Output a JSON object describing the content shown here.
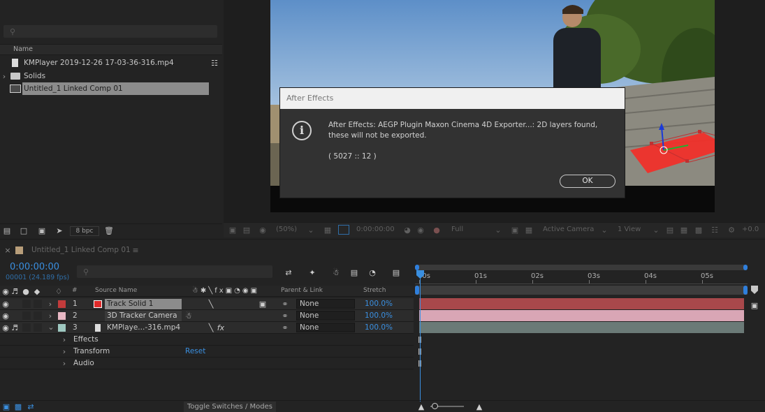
{
  "project": {
    "search_placeholder": "",
    "column_name": "Name",
    "items": [
      {
        "label": "KMPlayer 2019-12-26 17-03-36-316.mp4",
        "icon": "video-file-icon"
      },
      {
        "label": "Solids",
        "icon": "folder-icon"
      },
      {
        "label": "Untitled_1 Linked Comp 01",
        "icon": "composition-icon",
        "selected": true
      }
    ],
    "bpc": "8 bpc"
  },
  "viewer": {
    "zoom": "(50%)",
    "timecode": "0:00:00:00",
    "resolution": "Full",
    "camera": "Active Camera",
    "views": "1 View",
    "exposure": "+0.0"
  },
  "dialog": {
    "title": "After Effects",
    "message": "After Effects: AEGP Plugin Maxon Cinema 4D Exporter...: 2D layers found, these will not be exported.",
    "code": "( 5027 :: 12 )",
    "ok_label": "OK"
  },
  "timeline": {
    "comp_tab": "Untitled_1 Linked Comp 01",
    "timecode": "0:00:00:00",
    "frame_info": "00001 (24.189 fps)",
    "headers": {
      "number": "#",
      "source_name": "Source Name",
      "parent": "Parent & Link",
      "stretch": "Stretch"
    },
    "ruler": [
      "00s",
      "01s",
      "02s",
      "03s",
      "04s",
      "05s"
    ],
    "layers": [
      {
        "num": "1",
        "name": "Track Solid 1",
        "parent": "None",
        "stretch": "100.0%",
        "label_color": "#c23b3b",
        "swatch": "#e02a2a",
        "track_color": "#a8484b"
      },
      {
        "num": "2",
        "name": "3D Tracker Camera",
        "parent": "None",
        "stretch": "100.0%",
        "label_color": "#e8b8c4",
        "track_color": "#d9a6b5"
      },
      {
        "num": "3",
        "name": "KMPlaye...-316.mp4",
        "parent": "None",
        "stretch": "100.0%",
        "label_color": "#9ec8c0",
        "track_color": "#6b7a77"
      }
    ],
    "props": [
      {
        "label": "Effects"
      },
      {
        "label": "Transform",
        "value": "Reset"
      },
      {
        "label": "Audio"
      }
    ],
    "toggle_label": "Toggle Switches / Modes"
  }
}
